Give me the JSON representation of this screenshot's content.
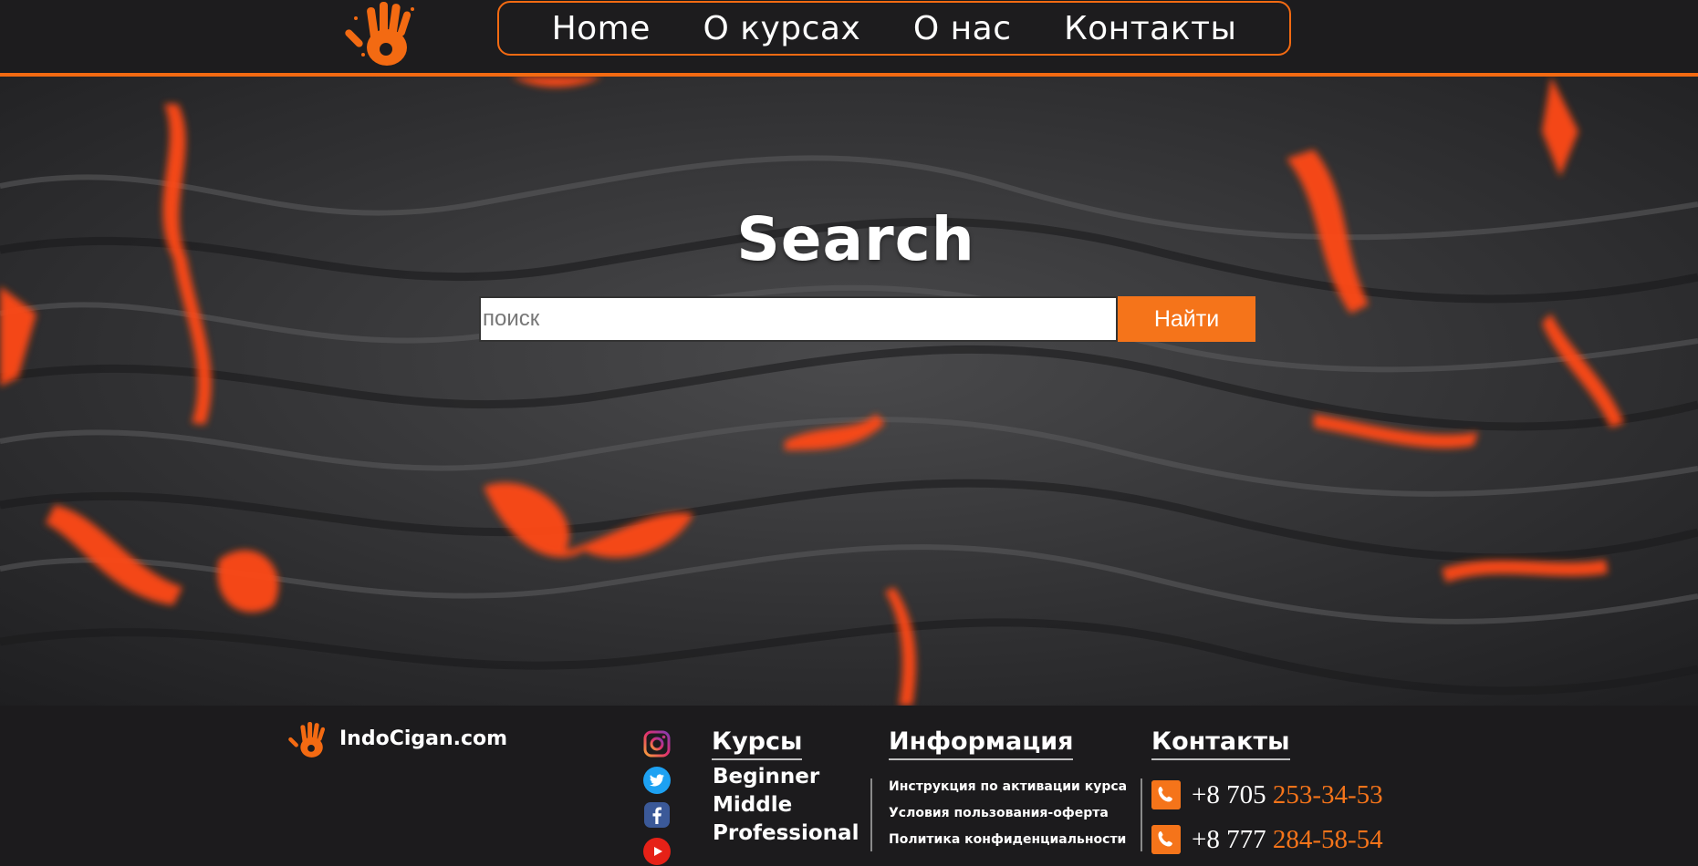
{
  "nav": {
    "items": [
      "Home",
      "О курсах",
      "О нас",
      "Контакты"
    ]
  },
  "hero": {
    "title": "Search",
    "search_placeholder": "поиск",
    "search_button": "Найти"
  },
  "footer": {
    "brand": "IndoCigan.com",
    "social_icons": [
      "instagram-icon",
      "twitter-icon",
      "facebook-icon",
      "youtube-icon"
    ],
    "courses": {
      "heading": "Курсы",
      "items": [
        "Beginner",
        "Middle",
        "Professional"
      ]
    },
    "info": {
      "heading": "Информация",
      "items": [
        "Инструкция по активации курса",
        "Условия пользования-оферта",
        "Политика конфиденциальности"
      ]
    },
    "contacts": {
      "heading": "Контакты",
      "phones": [
        {
          "prefix": "+8 705",
          "number": "253-34-53"
        },
        {
          "prefix": "+8 777",
          "number": "284-58-54"
        }
      ]
    }
  },
  "colors": {
    "accent": "#f5741a",
    "header_bg": "#1d1c1e",
    "footer_bg": "#1c1b1d"
  }
}
